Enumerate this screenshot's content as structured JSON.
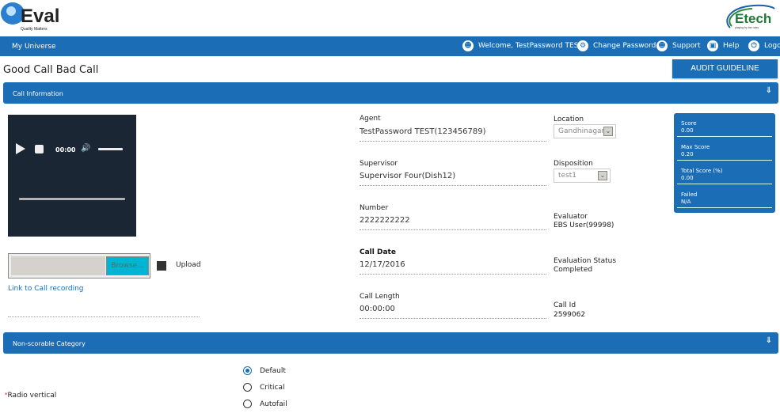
{
  "branding": {
    "left_logo_text": "Q-Eval",
    "left_logo_tagline": "Quality Matters",
    "right_logo_text": "Etech",
    "right_logo_tagline": "playing by the rules"
  },
  "topnav": {
    "brand": "My Universe",
    "items": [
      {
        "icon": "user-icon",
        "label": "Welcome, TestPassword TEST"
      },
      {
        "icon": "gear-icon",
        "label": "Change Password"
      },
      {
        "icon": "support-icon",
        "label": "Support"
      },
      {
        "icon": "help-book-icon",
        "label": "Help"
      },
      {
        "icon": "power-icon",
        "label": "Logout"
      }
    ]
  },
  "page": {
    "title": "Good Call Bad Call",
    "audit_button": "AUDIT GUIDELINE"
  },
  "sections": {
    "call_info": "Call Information",
    "non_scorable": "Non-scorable Category"
  },
  "player": {
    "time": "00:00",
    "volume_fraction": 0.85,
    "progress_fraction": 0
  },
  "upload": {
    "browse_label": "Browse...",
    "upload_label": "Upload",
    "link_label": "Link to Call recording"
  },
  "fields": {
    "agent": {
      "label": "Agent",
      "value": "TestPassword TEST(123456789)"
    },
    "supervisor": {
      "label": "Supervisor",
      "value": "Supervisor Four(Dish12)"
    },
    "number": {
      "label": "Number",
      "value": "2222222222"
    },
    "call_date": {
      "label": "Call Date",
      "value": "12/17/2016"
    },
    "call_length": {
      "label": "Call Length",
      "value": "00:00:00"
    },
    "location": {
      "label": "Location",
      "value": "Gandhinagar"
    },
    "disposition": {
      "label": "Disposition",
      "value": "test1"
    },
    "evaluator": {
      "label": "Evaluator",
      "value": "EBS User(99998)"
    },
    "evaluation_status": {
      "label": "Evaluation Status",
      "value": "Completed"
    },
    "call_id": {
      "label": "Call Id",
      "value": "2599062"
    }
  },
  "score_panel": [
    {
      "label": "Score",
      "value": "0.00"
    },
    {
      "label": "Max Score",
      "value": "0.20"
    },
    {
      "label": "Total Score (%)",
      "value": "0.00"
    },
    {
      "label": "Failed",
      "value": "N/A"
    }
  ],
  "radio_question": {
    "required_mark": "*",
    "label": "Radio vertical",
    "options": [
      {
        "label": "Default",
        "checked": true
      },
      {
        "label": "Critical",
        "checked": false
      },
      {
        "label": "Autofail",
        "checked": false
      }
    ]
  },
  "colors": {
    "brand_blue": "#1b6db5",
    "player_bg": "#1a2633",
    "browse_btn": "#00b4d4"
  }
}
